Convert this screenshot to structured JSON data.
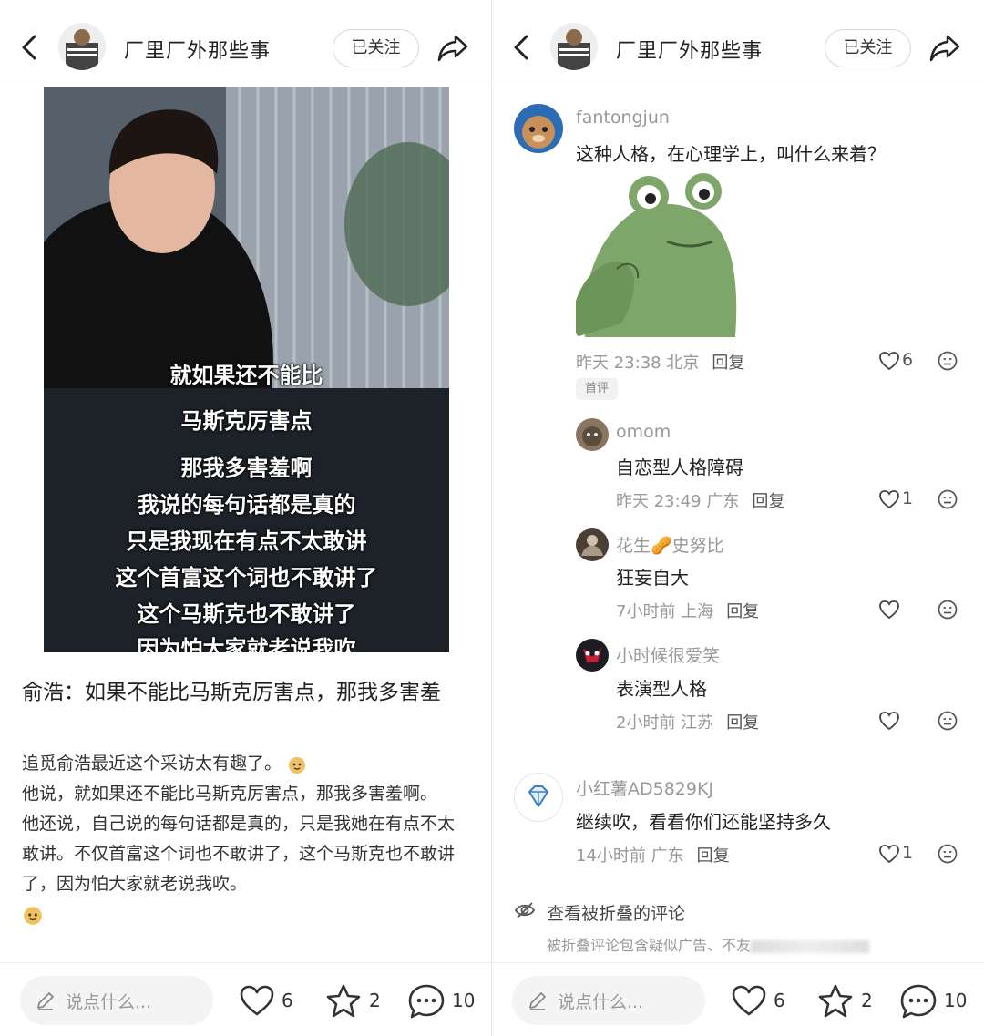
{
  "header": {
    "title": "厂里厂外那些事",
    "follow_label": "已关注"
  },
  "post": {
    "subtitles": [
      "就如果还不能比",
      "马斯克厉害点",
      "那我多害羞啊",
      "我说的每句话都是真的",
      "只是我现在有点不太敢讲",
      "这个首富这个词也不敢讲了",
      "这个马斯克也不敢讲了",
      "因为怕大家就老说我吹"
    ],
    "title": "俞浩：如果不能比马斯克厉害点，那我多害羞",
    "body": [
      "追觅俞浩最近这个采访太有趣了。",
      "他说，就如果还不能比马斯克厉害点，那我多害羞啊。",
      "他还说，自己说的每句话都是真的，只是我她在有点不太敢讲。不仅首富这个词也不敢讲了，这个马斯克也不敢讲了，因为怕大家就老说我吹。"
    ]
  },
  "bottom_bar": {
    "placeholder": "说点什么...",
    "likes": "6",
    "stars": "2",
    "comments": "10"
  },
  "comments": [
    {
      "user": "fantongjun",
      "text": "这种人格，在心理学上，叫什么来着？",
      "time": "昨天 23:38 北京",
      "reply_label": "回复",
      "likes": "6",
      "badge": "首评",
      "replies": [
        {
          "user": "omom",
          "text": "自恋型人格障碍",
          "time": "昨天 23:49 广东",
          "reply_label": "回复",
          "likes": "1"
        },
        {
          "user": "花生🥜史努比",
          "text": "狂妄自大",
          "time": "7小时前 上海",
          "reply_label": "回复",
          "likes": ""
        },
        {
          "user": "小时候很爱笑",
          "text": "表演型人格",
          "time": "2小时前 江苏",
          "reply_label": "回复",
          "likes": ""
        }
      ]
    },
    {
      "user": "小红薯AD5829KJ",
      "text": "继续吹，看看你们还能坚持多久",
      "time": "14小时前 广东",
      "reply_label": "回复",
      "likes": "1"
    }
  ],
  "folded": {
    "title": "查看被折叠的评论",
    "subtitle": "被折叠评论包含疑似广告、不友"
  },
  "colors": {
    "like_outline": "#333333",
    "muted": "#999999"
  }
}
